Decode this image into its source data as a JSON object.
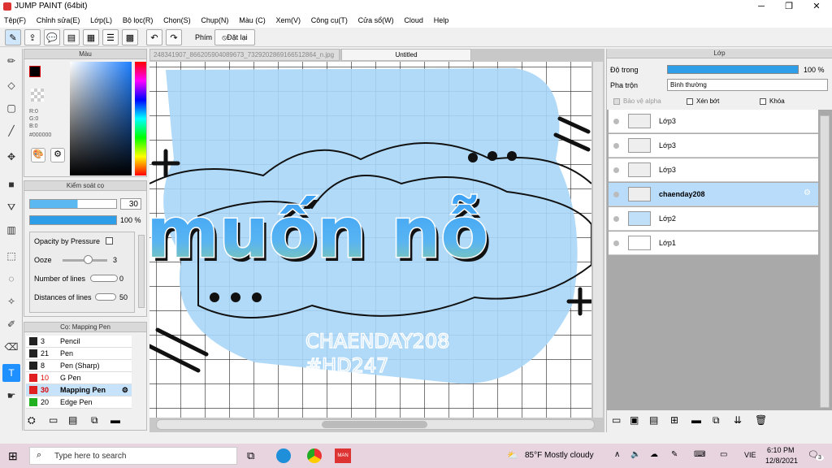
{
  "window": {
    "title": "JUMP PAINT (64bit)",
    "minimize": "─",
    "maximize": "❐",
    "close": "✕"
  },
  "menu": [
    "Tệp(F)",
    "Chỉnh sửa(E)",
    "Lớp(L)",
    "Bộ lọc(R)",
    "Chọn(S)",
    "Chụp(N)",
    "Màu (C)",
    "Xem(V)",
    "Công cụ(T)",
    "Cửa sổ(W)",
    "Cloud",
    "Help"
  ],
  "toolbar": {
    "phim_label": "Phím",
    "reset_label": "Đặt lại"
  },
  "color_panel": {
    "title": "Màu",
    "r": "R:0",
    "g": "G:0",
    "b": "B:0",
    "hex": "#000000"
  },
  "brush_control": {
    "title": "Kiểm soát cọ",
    "size": "30",
    "opacity": "100 %",
    "opacity_by_pressure": "Opacity by Pressure",
    "ooze_label": "Ooze",
    "ooze_value": "3",
    "lines_label": "Number of lines",
    "lines_value": "0",
    "dist_label": "Distances of lines",
    "dist_value": "50"
  },
  "brush_list": {
    "title": "Cọ: Mapping Pen",
    "items": [
      {
        "size": "3",
        "name": "Pencil",
        "color": "#222222",
        "selected": false
      },
      {
        "size": "21",
        "name": "Pen",
        "color": "#222222",
        "selected": false
      },
      {
        "size": "8",
        "name": "Pen (Sharp)",
        "color": "#222222",
        "selected": false
      },
      {
        "size": "10",
        "name": "G Pen",
        "color": "#e02020",
        "selected": false
      },
      {
        "size": "30",
        "name": "Mapping Pen",
        "color": "#e02020",
        "selected": true
      },
      {
        "size": "20",
        "name": "Edge Pen",
        "color": "#20b020",
        "selected": false
      }
    ]
  },
  "tabs": {
    "file": "248341907_866205904089673_7329202869166512864_n.jpg",
    "untitled": "Untitled"
  },
  "artwork": {
    "big_text": "muốn nỗ",
    "line1": "CHAENDAY208",
    "line2": "#HD247"
  },
  "layer_panel": {
    "title": "Lớp",
    "opacity_label": "Độ trong",
    "opacity_value": "100 %",
    "blend_label": "Pha trộn",
    "blend_value": "Bình thường",
    "protect_alpha": "Bảo vệ alpha",
    "clip": "Xén bớt",
    "lock": "Khóa"
  },
  "layers": [
    {
      "name": "Lớp3",
      "selected": false
    },
    {
      "name": "Lớp3",
      "selected": false
    },
    {
      "name": "Lớp3",
      "selected": false
    },
    {
      "name": "chaenday208",
      "selected": true
    },
    {
      "name": "Lớp2",
      "selected": false
    },
    {
      "name": "Lớp1",
      "selected": false
    }
  ],
  "taskbar": {
    "search": "Type here to search",
    "weather": "85°F  Mostly cloudy",
    "lang": "VIE",
    "time": "6:10 PM",
    "date": "12/8/2021",
    "notif": "3"
  }
}
